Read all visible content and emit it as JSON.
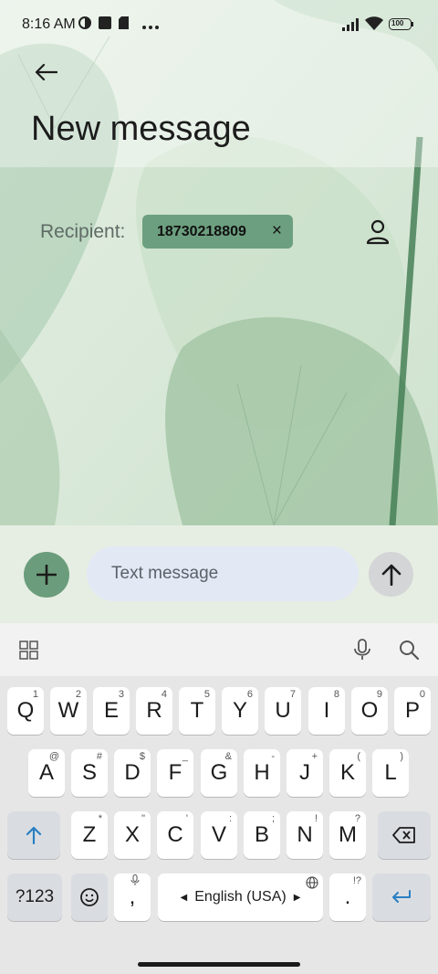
{
  "status_bar": {
    "time": "8:16 AM",
    "battery": "100"
  },
  "header": {
    "title": "New message"
  },
  "recipient": {
    "label": "Recipient:",
    "chip_value": "18730218809",
    "chip_remove": "×"
  },
  "compose": {
    "placeholder": "Text message"
  },
  "keyboard": {
    "row1": [
      {
        "k": "Q",
        "h": "1"
      },
      {
        "k": "W",
        "h": "2"
      },
      {
        "k": "E",
        "h": "3"
      },
      {
        "k": "R",
        "h": "4"
      },
      {
        "k": "T",
        "h": "5"
      },
      {
        "k": "Y",
        "h": "6"
      },
      {
        "k": "U",
        "h": "7"
      },
      {
        "k": "I",
        "h": "8"
      },
      {
        "k": "O",
        "h": "9"
      },
      {
        "k": "P",
        "h": "0"
      }
    ],
    "row2": [
      {
        "k": "A",
        "h": "@"
      },
      {
        "k": "S",
        "h": "#"
      },
      {
        "k": "D",
        "h": "$"
      },
      {
        "k": "F",
        "h": "_"
      },
      {
        "k": "G",
        "h": "&"
      },
      {
        "k": "H",
        "h": "-"
      },
      {
        "k": "J",
        "h": "+"
      },
      {
        "k": "K",
        "h": "("
      },
      {
        "k": "L",
        "h": ")"
      }
    ],
    "row3": [
      {
        "k": "Z",
        "h": "*"
      },
      {
        "k": "X",
        "h": "\""
      },
      {
        "k": "C",
        "h": "'"
      },
      {
        "k": "V",
        "h": ":"
      },
      {
        "k": "B",
        "h": ";"
      },
      {
        "k": "N",
        "h": "!"
      },
      {
        "k": "M",
        "h": "?"
      }
    ],
    "symbols_label": "?123",
    "comma": ",",
    "space_label": "English (USA)",
    "period": ".",
    "period_hint": "!?"
  }
}
